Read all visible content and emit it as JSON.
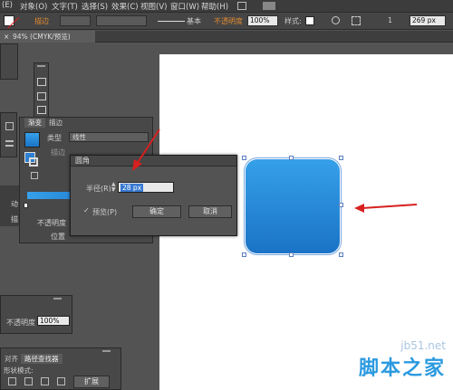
{
  "menubar": {
    "items": [
      "(E)",
      "对象(O)",
      "文字(T)",
      "选择(S)",
      "效果(C)",
      "视图(V)",
      "窗口(W)",
      "帮助(H)"
    ]
  },
  "control_bar": {
    "stroke_label": "描边",
    "stroke_style": "基本",
    "opacity_label": "不透明度",
    "opacity_value": "100%",
    "style_label": "样式:",
    "x_value": "1",
    "w_value": "269 px"
  },
  "document_tab": {
    "title": "94% (CMYK/预览)"
  },
  "gradient_panel": {
    "tabs": [
      "渐变",
      "描边"
    ],
    "type_label": "类型",
    "type_value": "线性",
    "stroke_label": "描边",
    "opacity_label": "不透明度",
    "position_label": "位置"
  },
  "side_labels": {
    "left_letter": "动",
    "left_letter2": "描"
  },
  "transparency_panel": {
    "opacity_label": "不透明度",
    "opacity_value": "100%"
  },
  "pathfinder_panel": {
    "tabs": [
      "对齐",
      "路径查找器"
    ],
    "shape_mode_label": "形状模式:",
    "expand_label": "扩展"
  },
  "dialog": {
    "title": "圆角",
    "radius_label": "半径(R):",
    "radius_value": "28 px",
    "preview_label": "预览(P)",
    "ok_label": "确定",
    "cancel_label": "取消"
  },
  "watermark": {
    "site": "jb51.net",
    "brand": "脚本之家"
  },
  "colors": {
    "accent_blue": "#2f8ee0",
    "arrow_red": "#d82020"
  }
}
